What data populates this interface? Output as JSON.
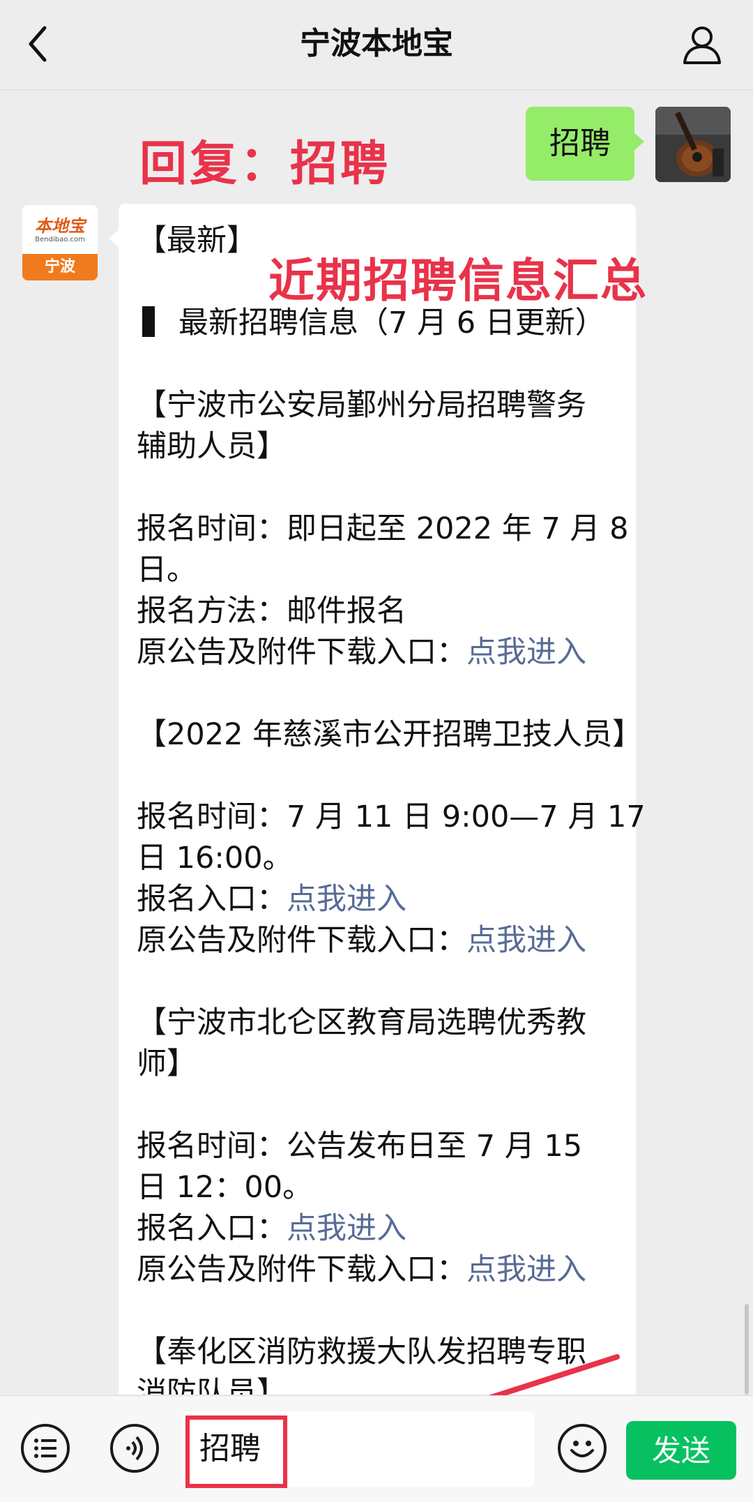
{
  "header": {
    "title": "宁波本地宝"
  },
  "annotations": {
    "reply_note": "回复：招聘",
    "summary_note": "近期招聘信息汇总"
  },
  "my_message": {
    "text": "招聘"
  },
  "bot": {
    "avatar_brand": "本地宝",
    "avatar_domain": "Bendibao.com",
    "avatar_city": "宁波"
  },
  "reply": {
    "lines": [
      {
        "t": "【最新】"
      },
      {
        "gap": true
      },
      {
        "t": "最新招聘信息（7 月 6 日更新）",
        "bar": true
      },
      {
        "gap": true
      },
      {
        "t": "【宁波市公安局鄞州分局招聘警务"
      },
      {
        "t": "辅助人员】"
      },
      {
        "gap": true
      },
      {
        "t": "报名时间：即日起至 2022 年 7 月 8"
      },
      {
        "t": "日。"
      },
      {
        "t": "报名方法：邮件报名"
      },
      {
        "t": "原公告及附件下载入口：",
        "link": "点我进入"
      },
      {
        "gap": true
      },
      {
        "t": "【2022 年慈溪市公开招聘卫技人员】"
      },
      {
        "gap": true
      },
      {
        "t": "报名时间：7 月 11 日 9:00—7 月 17"
      },
      {
        "t": "日 16:00。"
      },
      {
        "t": "报名入口：",
        "link": "点我进入"
      },
      {
        "t": "原公告及附件下载入口：",
        "link": "点我进入"
      },
      {
        "gap": true
      },
      {
        "t": "【宁波市北仑区教育局选聘优秀教"
      },
      {
        "t": "师】"
      },
      {
        "gap": true
      },
      {
        "t": "报名时间：公告发布日至 7 月 15"
      },
      {
        "t": "日 12：00。"
      },
      {
        "t": "报名入口：",
        "link": "点我进入"
      },
      {
        "t": "原公告及附件下载入口：",
        "link": "点我进入"
      },
      {
        "gap": true
      },
      {
        "t": "【奉化区消防救援大队发招聘专职"
      },
      {
        "t": "消防队员】"
      }
    ]
  },
  "input": {
    "value": "招聘"
  },
  "send": {
    "label": "发送"
  },
  "colors": {
    "accent_red": "#e8334a",
    "send_green": "#07c160",
    "bubble_green": "#95ec69",
    "link": "#576b95"
  },
  "icons": [
    "back-arrow-icon",
    "user-icon",
    "menu-list-icon",
    "voice-icon",
    "emoji-icon"
  ]
}
